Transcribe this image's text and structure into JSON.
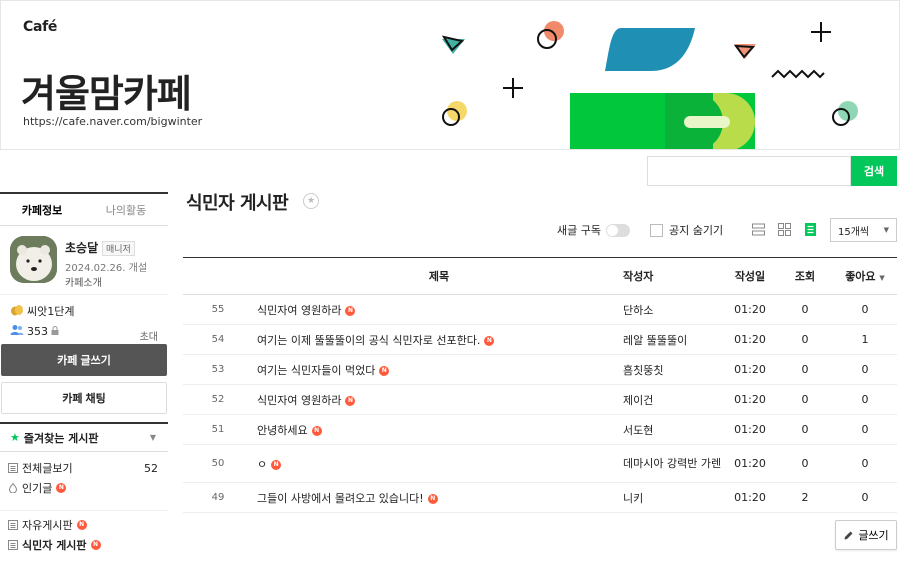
{
  "banner": {
    "logo": "Café",
    "title": "겨울맘카페",
    "url": "https://cafe.naver.com/bigwinter"
  },
  "search": {
    "placeholder": "",
    "button_label": "검색",
    "accent": "#03c75a"
  },
  "sidebar": {
    "tabs": [
      {
        "label": "카페정보",
        "active": true
      },
      {
        "label": "나의활동",
        "active": false
      }
    ],
    "profile": {
      "name": "초승달",
      "role": "매니저",
      "date": "2024.02.26. 개설",
      "intro": "카페소개"
    },
    "stats": {
      "level": "씨앗1단계",
      "members": "353",
      "invite": "초대"
    },
    "write_button": "카페 글쓰기",
    "chat_button": "카페 채팅",
    "favorites_label": "즐겨찾는 게시판",
    "menu": [
      {
        "label": "전체글보기",
        "count": "52",
        "new": false,
        "icon": "list-icon"
      },
      {
        "label": "인기글",
        "count": "",
        "new": true,
        "icon": "fire-icon"
      },
      {
        "label": "자유게시판",
        "count": "",
        "new": true,
        "icon": "board-icon"
      },
      {
        "label": "식민자 게시판",
        "count": "",
        "new": true,
        "icon": "board-icon"
      }
    ],
    "new_badge": "N"
  },
  "board": {
    "title": "식민자 게시판",
    "subscribe_label": "새글 구독",
    "notice_label": "공지 숨기기",
    "per_page": "15개씩",
    "write_label": "글쓰기"
  },
  "table": {
    "headers": {
      "title": "제목",
      "writer": "작성자",
      "date": "작성일",
      "views": "조회",
      "likes": "좋아요"
    },
    "rows": [
      {
        "no": "55",
        "title": "식민자여 영원하라",
        "writer": "단하소",
        "date": "01:20",
        "views": "0",
        "likes": "0"
      },
      {
        "no": "54",
        "title": "여기는 이제 뚤뚤뚤이의 공식 식민자로 선포한다.",
        "writer": "레알 뚤뚤뚤이",
        "date": "01:20",
        "views": "0",
        "likes": "1"
      },
      {
        "no": "53",
        "title": "여기는 식민자들이 먹었다",
        "writer": "흠칫뚱칫",
        "date": "01:20",
        "views": "0",
        "likes": "0"
      },
      {
        "no": "52",
        "title": "식민자여 영원하라",
        "writer": "제이건",
        "date": "01:20",
        "views": "0",
        "likes": "0"
      },
      {
        "no": "51",
        "title": "안녕하세요",
        "writer": "서도현",
        "date": "01:20",
        "views": "0",
        "likes": "0"
      },
      {
        "no": "50",
        "title": "ㅇ",
        "writer": "데마시아 강력반 가렌",
        "date": "01:20",
        "views": "0",
        "likes": "0"
      },
      {
        "no": "49",
        "title": "그들이 사방에서 몰려오고 있습니다!",
        "writer": "니키",
        "date": "01:20",
        "views": "2",
        "likes": "0"
      }
    ]
  }
}
